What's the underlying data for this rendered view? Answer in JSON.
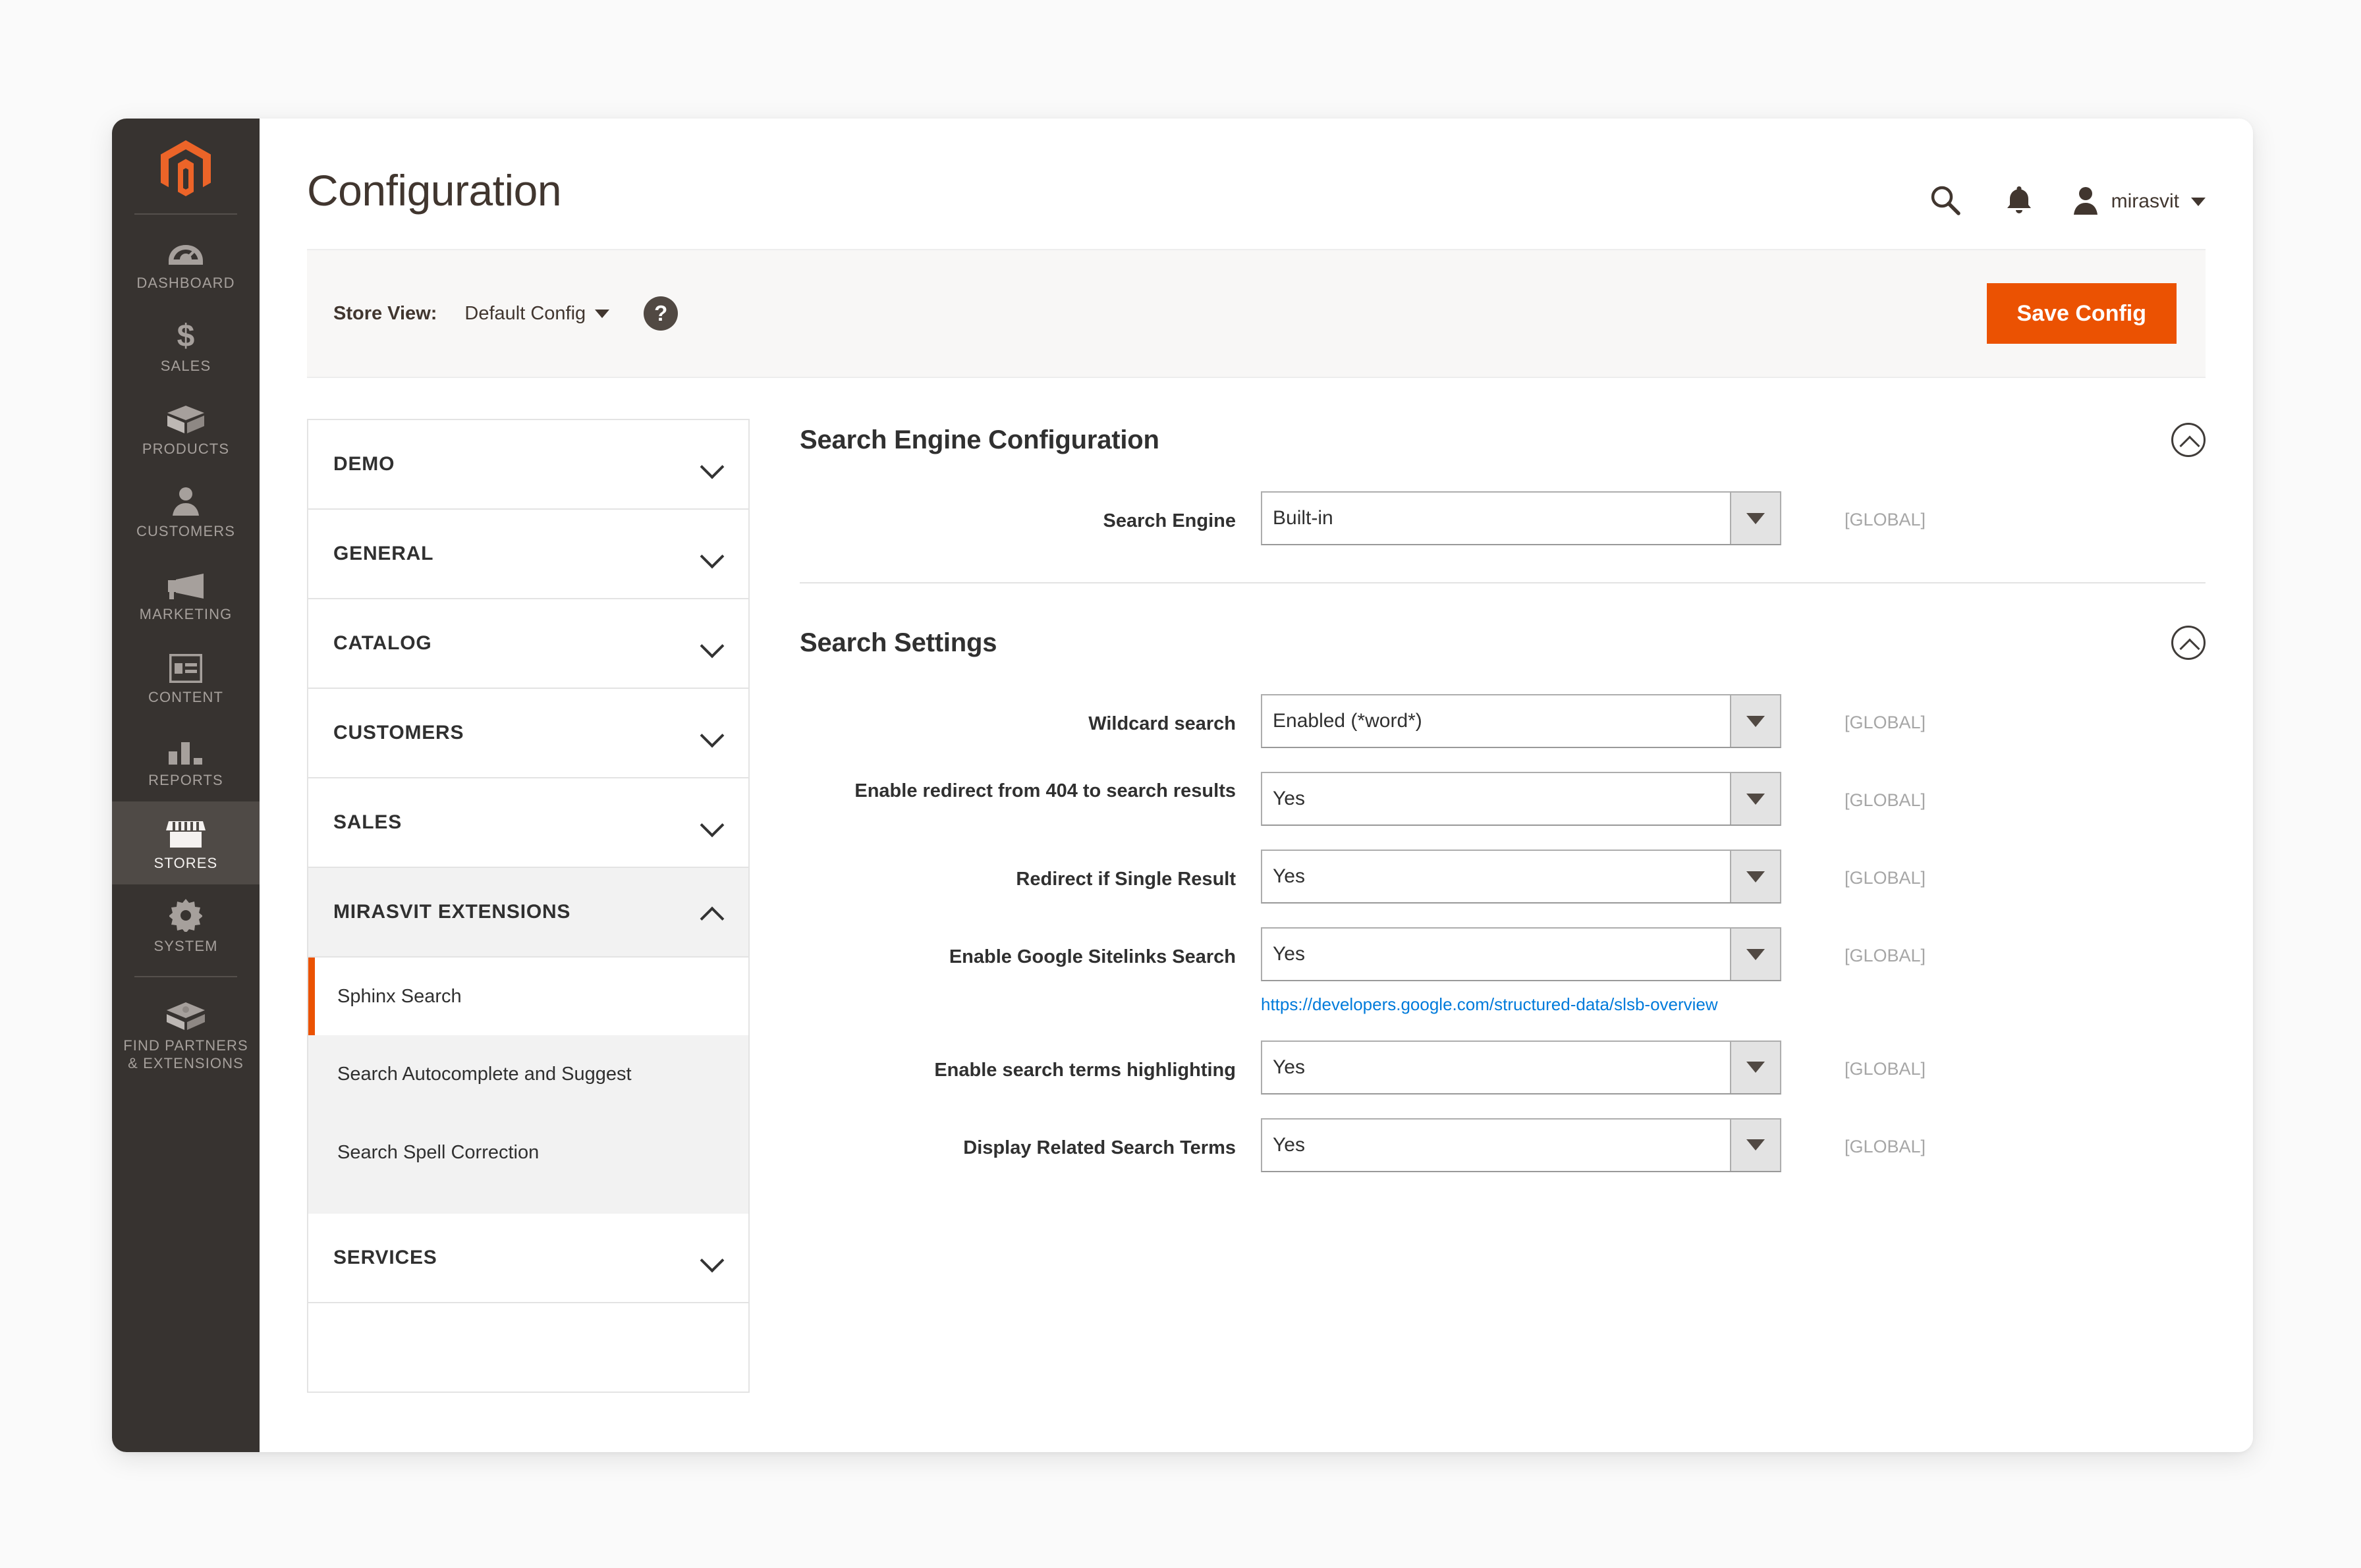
{
  "header": {
    "title": "Configuration",
    "search_icon": "search-icon",
    "notifications_icon": "bell-icon",
    "avatar_icon": "user-avatar-icon",
    "admin_user": "mirasvit",
    "user_caret": "chevron-down-icon"
  },
  "storeview": {
    "label": "Store View:",
    "value": "Default Config",
    "help_glyph": "?",
    "save_label": "Save Config",
    "accent": "#eb5202"
  },
  "global_nav": {
    "logo": "magento-logo",
    "items": [
      {
        "label": "DASHBOARD",
        "icon": "dashboard-gauge-icon",
        "selected": false
      },
      {
        "label": "SALES",
        "icon": "dollar-sign-icon",
        "selected": false
      },
      {
        "label": "PRODUCTS",
        "icon": "box-icon",
        "selected": false
      },
      {
        "label": "CUSTOMERS",
        "icon": "person-icon",
        "selected": false
      },
      {
        "label": "MARKETING",
        "icon": "megaphone-icon",
        "selected": false
      },
      {
        "label": "CONTENT",
        "icon": "layout-icon",
        "selected": false
      },
      {
        "label": "REPORTS",
        "icon": "bar-chart-icon",
        "selected": false
      },
      {
        "label": "STORES",
        "icon": "storefront-icon",
        "selected": true
      },
      {
        "label": "SYSTEM",
        "icon": "gear-icon",
        "selected": false
      },
      {
        "label": "FIND PARTNERS\n& EXTENSIONS",
        "icon": "partners-box-icon",
        "selected": false
      }
    ]
  },
  "config_nav": {
    "sections": [
      {
        "label": "DEMO",
        "state": "collapsed"
      },
      {
        "label": "GENERAL",
        "state": "collapsed"
      },
      {
        "label": "CATALOG",
        "state": "collapsed"
      },
      {
        "label": "CUSTOMERS",
        "state": "collapsed"
      },
      {
        "label": "SALES",
        "state": "collapsed"
      },
      {
        "label": "MIRASVIT EXTENSIONS",
        "state": "expanded"
      },
      {
        "label": "SERVICES",
        "state": "collapsed"
      }
    ],
    "mirasvit_children": [
      {
        "label": "Sphinx Search",
        "active": true
      },
      {
        "label": "Search Autocomplete and Suggest",
        "active": false
      },
      {
        "label": "Search Spell Correction",
        "active": false
      }
    ]
  },
  "settings": {
    "engine_section": {
      "title": "Search Engine Configuration",
      "toggle_icon": "chevron-up-circle-icon",
      "fields": [
        {
          "label": "Search Engine",
          "value": "Built-in",
          "scope": "[GLOBAL]"
        }
      ]
    },
    "search_settings": {
      "title": "Search Settings",
      "toggle_icon": "chevron-up-circle-icon",
      "fields": [
        {
          "label": "Wildcard search",
          "value": "Enabled (*word*)",
          "scope": "[GLOBAL]"
        },
        {
          "label": "Enable redirect from 404 to search results",
          "value": "Yes",
          "scope": "[GLOBAL]"
        },
        {
          "label": "Redirect if Single Result",
          "value": "Yes",
          "scope": "[GLOBAL]"
        },
        {
          "label": "Enable Google Sitelinks Search",
          "value": "Yes",
          "scope": "[GLOBAL]",
          "note": "https://developers.google.com/structured-data/slsb-overview"
        },
        {
          "label": "Enable search terms highlighting",
          "value": "Yes",
          "scope": "[GLOBAL]"
        },
        {
          "label": "Display Related Search Terms",
          "value": "Yes",
          "scope": "[GLOBAL]"
        }
      ]
    }
  }
}
